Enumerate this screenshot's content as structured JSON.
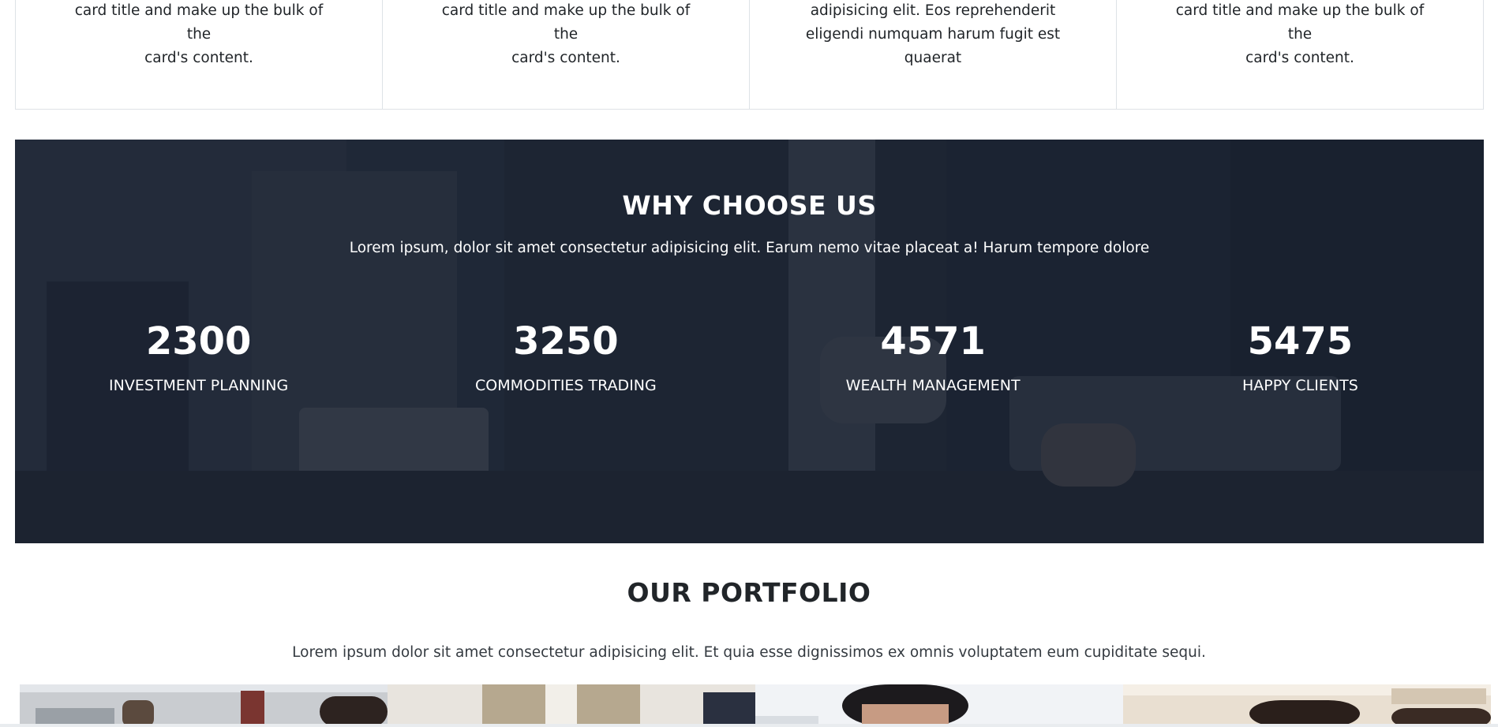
{
  "cards": [
    {
      "text_lines": [
        "card title and make up the bulk of the",
        "card's content."
      ]
    },
    {
      "text_lines": [
        "card title and make up the bulk of the",
        "card's content."
      ]
    },
    {
      "text_lines": [
        "adipisicing elit. Eos reprehenderit",
        "eligendi numquam harum fugit est",
        "quaerat"
      ]
    },
    {
      "text_lines": [
        "card title and make up the bulk of the",
        "card's content."
      ]
    }
  ],
  "why": {
    "title": "WHY CHOOSE US",
    "subtitle": "Lorem ipsum, dolor sit amet consectetur adipisicing elit. Earum nemo vitae placeat a! Harum tempore dolore",
    "stats": [
      {
        "number": "2300",
        "label": "INVESTMENT PLANNING"
      },
      {
        "number": "3250",
        "label": "COMMODITIES TRADING"
      },
      {
        "number": "4571",
        "label": "WEALTH MANAGEMENT"
      },
      {
        "number": "5475",
        "label": "HAPPY CLIENTS"
      }
    ]
  },
  "portfolio": {
    "title": "OUR PORTFOLIO",
    "subtitle": "Lorem ipsum dolor sit amet consectetur adipisicing elit. Et quia esse dignissimos ex omnis voluptatem eum cupiditate sequi.",
    "thumbnails": [
      "office-photo-1",
      "office-photo-2",
      "office-photo-3",
      "office-photo-4"
    ]
  },
  "colors": {
    "section_dark": "#1e2736",
    "text_light": "#ffffff",
    "text_dark": "#212529",
    "border": "#dee2e6"
  }
}
